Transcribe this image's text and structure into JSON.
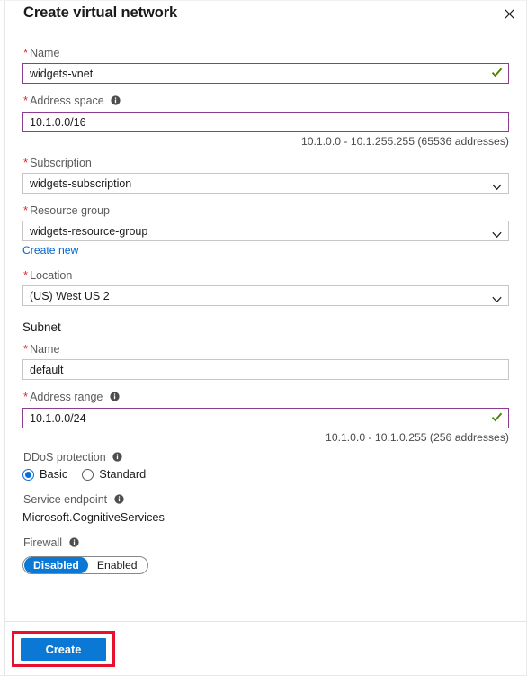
{
  "header": {
    "title": "Create virtual network",
    "close_icon": "close-icon"
  },
  "form": {
    "name": {
      "label": "Name",
      "required_marker": "*",
      "value": "widgets-vnet",
      "placeholder": "",
      "validation_icon": "checkmark-icon",
      "valid": true
    },
    "address_space": {
      "label": "Address space",
      "required_marker": "*",
      "info_icon": "info-icon",
      "value": "10.1.0.0/16",
      "placeholder": "",
      "hint": "10.1.0.0 - 10.1.255.255 (65536 addresses)"
    },
    "subscription": {
      "label": "Subscription",
      "required_marker": "*",
      "value": "widgets-subscription",
      "options": [
        "widgets-subscription"
      ],
      "chevron_icon": "chevron-down-icon"
    },
    "resource_group": {
      "label": "Resource group",
      "required_marker": "*",
      "value": "widgets-resource-group",
      "options": [
        "widgets-resource-group"
      ],
      "chevron_icon": "chevron-down-icon",
      "create_new_link": "Create new"
    },
    "location": {
      "label": "Location",
      "required_marker": "*",
      "value": "(US) West US 2",
      "options": [
        "(US) West US 2"
      ],
      "chevron_icon": "chevron-down-icon"
    },
    "subnet": {
      "section_title": "Subnet",
      "name": {
        "label": "Name",
        "required_marker": "*",
        "value": "default",
        "placeholder": ""
      },
      "address_range": {
        "label": "Address range",
        "required_marker": "*",
        "info_icon": "info-icon",
        "value": "10.1.0.0/24",
        "placeholder": "",
        "validation_icon": "checkmark-icon",
        "valid": true,
        "hint": "10.1.0.0 - 10.1.0.255 (256 addresses)"
      }
    },
    "ddos_protection": {
      "label": "DDoS protection",
      "info_icon": "info-icon",
      "options": [
        {
          "label": "Basic",
          "selected": true
        },
        {
          "label": "Standard",
          "selected": false
        }
      ]
    },
    "service_endpoint": {
      "label": "Service endpoint",
      "info_icon": "info-icon",
      "value": "Microsoft.CognitiveServices"
    },
    "firewall": {
      "label": "Firewall",
      "info_icon": "info-icon",
      "options": [
        {
          "label": "Disabled",
          "selected": true
        },
        {
          "label": "Enabled",
          "selected": false
        }
      ]
    }
  },
  "footer": {
    "create_label": "Create"
  },
  "colors": {
    "accent_blue": "#0a78d4",
    "link_blue": "#0066cc",
    "required_red": "#e3262e",
    "highlight_red": "#e8112d",
    "valid_border_purple": "#8d3d8d",
    "check_green": "#498205",
    "border_gray": "#c8c6c4"
  }
}
